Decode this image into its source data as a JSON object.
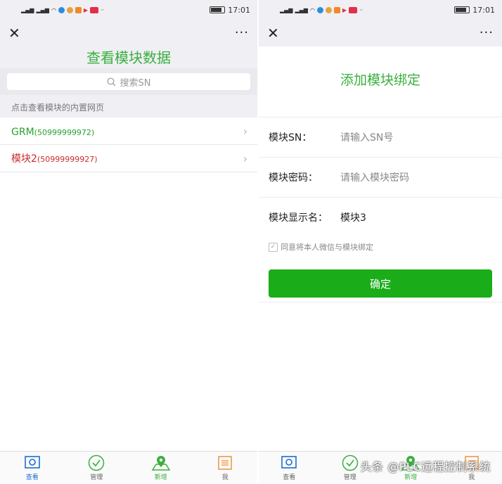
{
  "status": {
    "time": "17:01"
  },
  "left": {
    "title": "查看模块数据",
    "search_placeholder": "搜索SN",
    "hint": "点击查看模块的内置网页",
    "rows": [
      {
        "name": "GRM",
        "sn": "(50999999972)",
        "color": "#2aa12e"
      },
      {
        "name": "模块2",
        "sn": "(50999999927)",
        "color": "#cc2a2a"
      }
    ]
  },
  "right": {
    "title": "添加模块绑定",
    "fields": [
      {
        "label": "模块SN：",
        "value": "请输入SN号"
      },
      {
        "label": "模块密码：",
        "value": "请输入模块密码"
      },
      {
        "label": "模块显示名：",
        "value": "模块3"
      }
    ],
    "agree": "同意将本人微信与模块绑定",
    "confirm": "确定"
  },
  "tabs": [
    {
      "label": "查看"
    },
    {
      "label": "管理"
    },
    {
      "label": "新增"
    },
    {
      "label": "我"
    }
  ],
  "watermark": "头条 @PLC远程控制系统",
  "colors": {
    "accent": "#3ab03e",
    "button": "#1aad19",
    "blue": "#1b6ed1",
    "orange": "#f0913a"
  }
}
